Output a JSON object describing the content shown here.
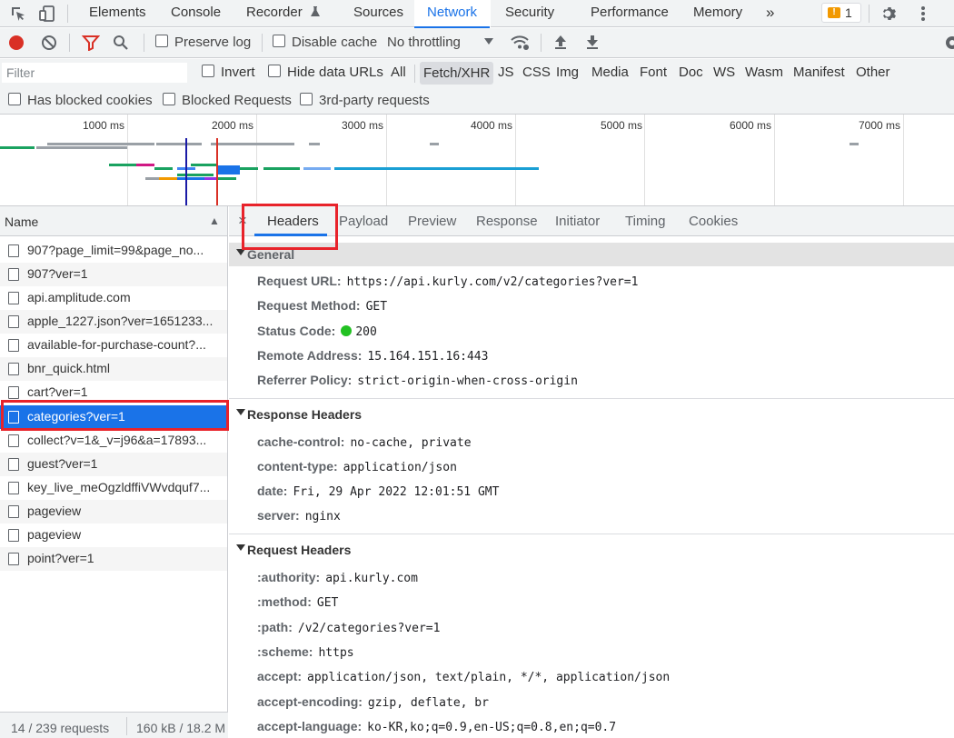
{
  "tabbar": {
    "tabs": [
      "Elements",
      "Console",
      "Recorder",
      "Sources",
      "Network",
      "Security",
      "Performance",
      "Memory"
    ],
    "more": "»",
    "issues_count": "1",
    "issues_icon": "!"
  },
  "toolbar": {
    "preserve_log": "Preserve log",
    "disable_cache": "Disable cache",
    "throttling": "No throttling"
  },
  "filter": {
    "placeholder": "Filter",
    "invert": "Invert",
    "hide_data_urls": "Hide data URLs",
    "types": [
      "All",
      "Fetch/XHR",
      "JS",
      "CSS",
      "Img",
      "Media",
      "Font",
      "Doc",
      "WS",
      "Wasm",
      "Manifest",
      "Other"
    ],
    "selected_type": "Fetch/XHR"
  },
  "checks": {
    "has_blocked_cookies": "Has blocked cookies",
    "blocked_requests": "Blocked Requests",
    "third_party": "3rd-party requests"
  },
  "overview": {
    "ticks": [
      "1000 ms",
      "2000 ms",
      "3000 ms",
      "4000 ms",
      "5000 ms",
      "6000 ms",
      "7000 ms"
    ]
  },
  "requests": {
    "header": "Name",
    "items": [
      "907?page_limit=99&page_no...",
      "907?ver=1",
      "api.amplitude.com",
      "apple_1227.json?ver=1651233...",
      "available-for-purchase-count?...",
      "bnr_quick.html",
      "cart?ver=1",
      "categories?ver=1",
      "collect?v=1&_v=j96&a=17893...",
      "guest?ver=1",
      "key_live_meOgzldffiVWvdquf7...",
      "pageview",
      "pageview",
      "point?ver=1"
    ],
    "selected_index": 7,
    "status_count": "14 / 239 requests",
    "status_size": "160 kB / 18.2 M"
  },
  "detail": {
    "close": "×",
    "tabs": [
      "Headers",
      "Payload",
      "Preview",
      "Response",
      "Initiator",
      "Timing",
      "Cookies"
    ],
    "active_tab": "Headers",
    "general": {
      "title": "General",
      "rows": [
        {
          "k": "Request URL:",
          "v": "https://api.kurly.com/v2/categories?ver=1"
        },
        {
          "k": "Request Method:",
          "v": "GET"
        },
        {
          "k": "Status Code:",
          "v": "200"
        },
        {
          "k": "Remote Address:",
          "v": "15.164.151.16:443"
        },
        {
          "k": "Referrer Policy:",
          "v": "strict-origin-when-cross-origin"
        }
      ]
    },
    "response_headers": {
      "title": "Response Headers",
      "rows": [
        {
          "k": "cache-control:",
          "v": "no-cache, private"
        },
        {
          "k": "content-type:",
          "v": "application/json"
        },
        {
          "k": "date:",
          "v": "Fri, 29 Apr 2022 12:01:51 GMT"
        },
        {
          "k": "server:",
          "v": "nginx"
        }
      ]
    },
    "request_headers": {
      "title": "Request Headers",
      "rows": [
        {
          "k": ":authority:",
          "v": "api.kurly.com"
        },
        {
          "k": ":method:",
          "v": "GET"
        },
        {
          "k": ":path:",
          "v": "/v2/categories?ver=1"
        },
        {
          "k": ":scheme:",
          "v": "https"
        },
        {
          "k": "accept:",
          "v": "application/json, text/plain, */*, application/json"
        },
        {
          "k": "accept-encoding:",
          "v": "gzip, deflate, br"
        },
        {
          "k": "accept-language:",
          "v": "ko-KR,ko;q=0.9,en-US;q=0.8,en;q=0.7"
        }
      ]
    }
  },
  "colors": {
    "accent": "#1a73e8",
    "annotation_red": "#e8232b",
    "status_ok": "#22c122",
    "record_red": "#d93025"
  }
}
